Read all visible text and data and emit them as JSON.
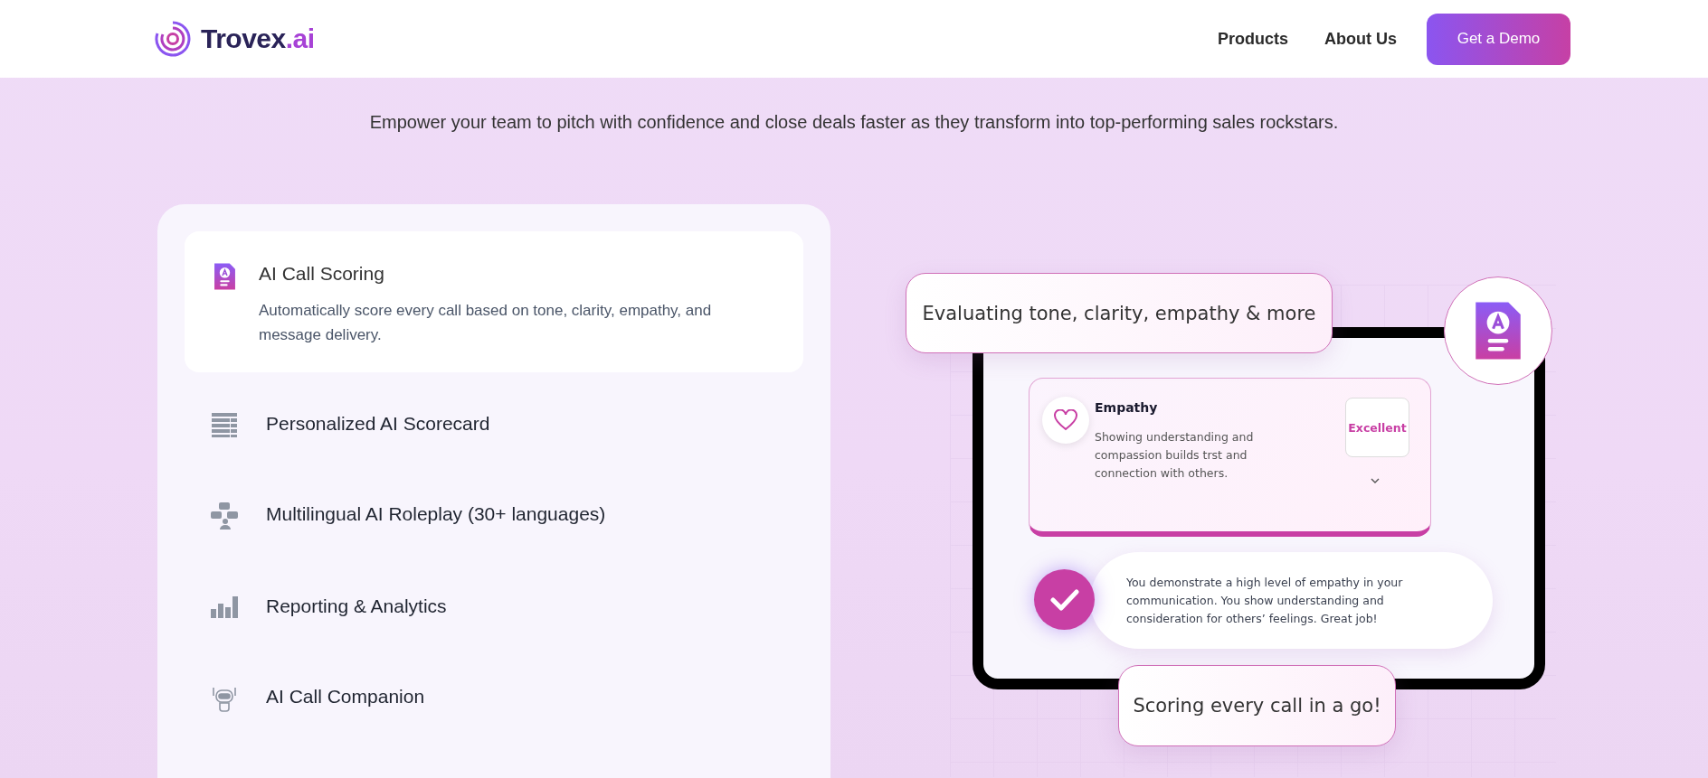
{
  "header": {
    "logo": {
      "name": "Trovex",
      "suffix": ".ai"
    },
    "nav": [
      {
        "label": "Products"
      },
      {
        "label": "About Us"
      }
    ],
    "cta": "Get a Demo"
  },
  "hero": {
    "subtitle": "Empower your team to pitch with confidence and close deals faster as they transform into top-performing sales rockstars."
  },
  "features": [
    {
      "kind": "scoring",
      "title": "AI Call Scoring",
      "description": "Automatically score every call based on tone, clarity, empathy, and message delivery.",
      "selected": true
    },
    {
      "kind": "scorecard",
      "title": "Personalized AI Scorecard",
      "selected": false
    },
    {
      "kind": "roleplay",
      "title": "Multilingual AI Roleplay (30+ languages)",
      "selected": false
    },
    {
      "kind": "reporting",
      "title": "Reporting & Analytics",
      "selected": false
    },
    {
      "kind": "companion",
      "title": "AI Call Companion",
      "selected": false
    }
  ],
  "illustration": {
    "top_caption": "Evaluating tone, clarity, empathy & more",
    "metric": {
      "title": "Empathy",
      "description": "Showing understanding and compassion builds trst and connection with others.",
      "rating": "Excellent"
    },
    "feedback": "You demonstrate a high level of empathy in your communication. You show understanding and consideration for others’ feelings. Great job!",
    "bottom_caption": "Scoring every call in a go!"
  }
}
